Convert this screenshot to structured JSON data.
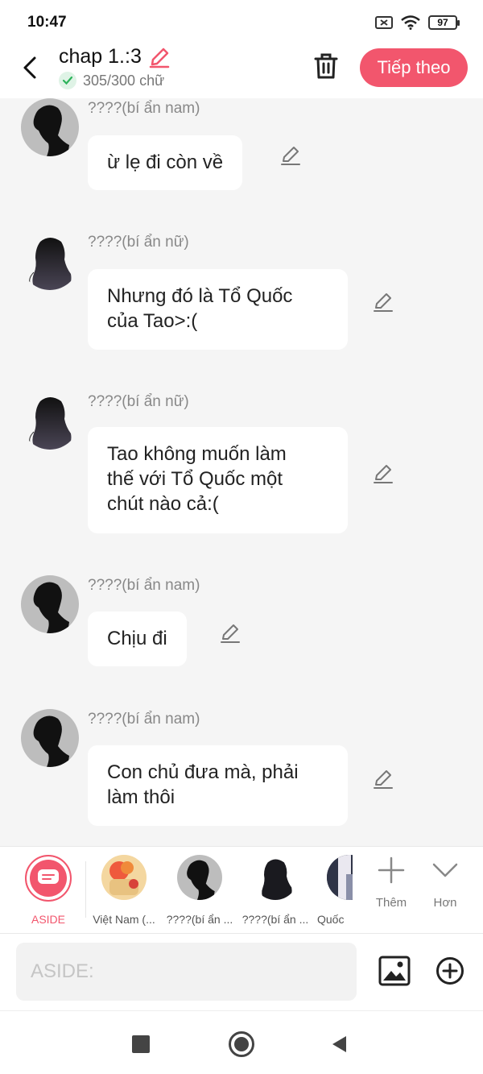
{
  "status_bar": {
    "time": "10:47",
    "battery": "97"
  },
  "header": {
    "title": "chap 1.:3",
    "word_count": "305/300 chữ",
    "next_label": "Tiếp theo"
  },
  "messages": [
    {
      "sender": "????(bí ẩn nam)",
      "gender": "male",
      "text": "ừ lẹ đi còn về"
    },
    {
      "sender": "????(bí ẩn nữ)",
      "gender": "female",
      "lines": [
        "Nhưng đó là Tổ Quốc",
        "của Tao>:("
      ]
    },
    {
      "sender": "????(bí ẩn nữ)",
      "gender": "female",
      "lines": [
        "Tao không muốn làm",
        "thế với Tổ Quốc một",
        "chút nào cả:("
      ]
    },
    {
      "sender": "????(bí ẩn nam)",
      "gender": "male",
      "text": "Chịu đi"
    },
    {
      "sender": "????(bí ẩn nam)",
      "gender": "male",
      "lines": [
        "Con chủ đưa mà, phải",
        "làm thôi"
      ]
    }
  ],
  "characters": [
    {
      "label": "ASIDE",
      "active": true
    },
    {
      "label": "Việt Nam (..."
    },
    {
      "label": "????(bí ẩn ..."
    },
    {
      "label": "????(bí ẩn ..."
    },
    {
      "label": "Quốc"
    }
  ],
  "tools": {
    "add_label": "Thêm",
    "more_label": "Hơn"
  },
  "input": {
    "placeholder": "ASIDE:"
  },
  "colors": {
    "accent": "#f2566d",
    "background": "#f5f5f5",
    "bubble": "#ffffff"
  }
}
